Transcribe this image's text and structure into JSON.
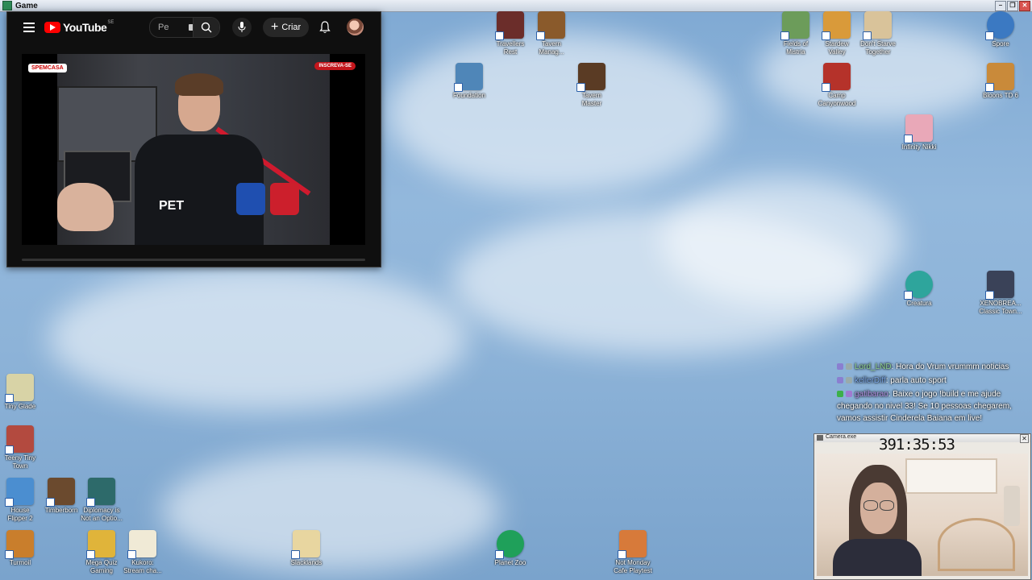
{
  "window": {
    "title": "Game"
  },
  "youtube": {
    "logo_text": "YouTube",
    "region": "SE",
    "search_text": "Pe",
    "create_label": "Criar",
    "video_badge_left": "SPEMCASA",
    "video_badge_right": "INSCREVA-SE",
    "video_sponsor": "PET"
  },
  "desktop_icons": [
    {
      "name": "Travellers Rest",
      "label": "Travellers\nRest",
      "color": "#6b2d2a"
    },
    {
      "name": "Tavern Manager",
      "label": "Tavern\nManag...",
      "color": "#8a5a2b"
    },
    {
      "name": "Foundation",
      "label": "Foundation",
      "color": "#4f86b8"
    },
    {
      "name": "Tavern Master",
      "label": "Tavern\nMaster",
      "color": "#5a3b24"
    },
    {
      "name": "Fields of Mistria",
      "label": "Fields of\nMistria",
      "color": "#6c9c5a"
    },
    {
      "name": "Stardew Valley",
      "label": "Stardew\nValley",
      "color": "#d99a3a"
    },
    {
      "name": "Don't Starve Together",
      "label": "Don't Starve\nTogether",
      "color": "#d9c39a"
    },
    {
      "name": "Spore",
      "label": "Spore",
      "color": "#3b79c2"
    },
    {
      "name": "Camp Canyonwood",
      "label": "Camp\nCanyonwood",
      "color": "#b5322a"
    },
    {
      "name": "Bloons TD 6",
      "label": "Bloons TD 6",
      "color": "#c98a3a"
    },
    {
      "name": "Infinity Nikki",
      "label": "Infinity Nikki",
      "color": "#e9a8b8"
    },
    {
      "name": "Creatura",
      "label": "Creatura",
      "color": "#2ea59c"
    },
    {
      "name": "XENOBREA Classic Town",
      "label": "XENOBREA...\nClassic Town...",
      "color": "#3a4258"
    },
    {
      "name": "Tiny Glade",
      "label": "Tiny Glade",
      "color": "#d8d3a6"
    },
    {
      "name": "Teeny Tiny Town",
      "label": "Teeny Tiny\nTown",
      "color": "#b34a3f"
    },
    {
      "name": "House Flipper 2",
      "label": "House\nFlipper 2",
      "color": "#4b8ed0"
    },
    {
      "name": "Timberborn",
      "label": "Timberborn",
      "color": "#6b4a2e"
    },
    {
      "name": "Diplomacy is Not an Option",
      "label": "Diplomacy is\nNot an Optio...",
      "color": "#2d6a6a"
    },
    {
      "name": "Turmoil",
      "label": "Turmoil",
      "color": "#c97e2c"
    },
    {
      "name": "Mega Quiz Gaming",
      "label": "Mega Quiz\nGaming",
      "color": "#e0b43a"
    },
    {
      "name": "Kukoro Stream chat",
      "label": "Kukoro:\nStream cha...",
      "color": "#f0ead6"
    },
    {
      "name": "Slacklands",
      "label": "Slacklands",
      "color": "#e8d6a0"
    },
    {
      "name": "Planet Zoo",
      "label": "Planet Zoo",
      "color": "#1fa05a"
    },
    {
      "name": "Not Monday Cafe Playtest",
      "label": "Not Monday\nCafe Playtest",
      "color": "#d77a3a"
    }
  ],
  "chat": [
    {
      "user": "Lord_LND",
      "message": ": Hora do Vrum vrummm noticias"
    },
    {
      "user": "kellerDiff",
      "message": ": parla auto sport"
    },
    {
      "user": "gatibarao",
      "message": ": Baixe o jogo !build e me ajude chegando no nivel 33! Se 10 pessoas chegarem, vamos assistir Cinderela Baiana em live!"
    }
  ],
  "camera": {
    "title": "Camera.exe",
    "timer": "391:35:53"
  }
}
